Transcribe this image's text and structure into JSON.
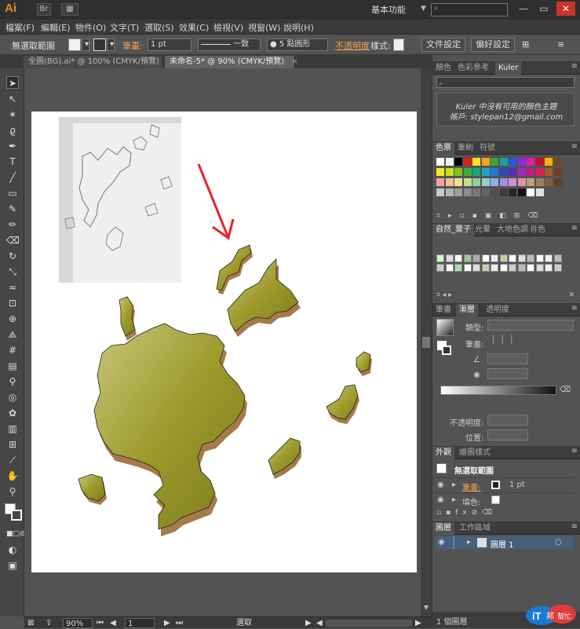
{
  "app": {
    "logo": "Ai",
    "workspace": "基本功能",
    "search_placeholder": "",
    "window_controls": [
      "—",
      "▭",
      "✕"
    ]
  },
  "menu": [
    "檔案(F)",
    "編輯(E)",
    "物件(O)",
    "文字(T)",
    "選取(S)",
    "效果(C)",
    "檢視(V)",
    "視窗(W)",
    "說明(H)"
  ],
  "control_bar": {
    "selection": "無選取範圍",
    "stroke_label": "筆畫:",
    "stroke_value": "1 pt",
    "stroke_style": "一致",
    "brush": "5 點圓形",
    "opacity_label": "不透明度",
    "style_label": "樣式:",
    "doc_setup_button": "文件設定",
    "prefs_button": "偏好設定"
  },
  "doc_tabs": [
    {
      "label": "全圖(BG).ai* @ 100% (CMYK/預覽)",
      "active": false
    },
    {
      "label": "未命名-5* @ 90% (CMYK/預覽)",
      "active": true
    }
  ],
  "status_bar": {
    "zoom": "90%",
    "page": "1",
    "status": "選取"
  },
  "panels": {
    "color_group": {
      "tabs": [
        "顏色",
        "色彩參考",
        "Kuler"
      ],
      "active": "Kuler",
      "message_line1": "Kuler 中沒有可用的顏色主題",
      "message_line2": "帳戶: stylepan12@gmail.com"
    },
    "swatches_group": {
      "tabs": [
        "色票",
        "筆刷",
        "符號"
      ],
      "active": "色票"
    },
    "library_group": {
      "tabs": [
        "自然_葉子",
        "光暈",
        "大地色調",
        "肖色"
      ],
      "active": "自然_葉子"
    },
    "gradient_group": {
      "tabs": [
        "筆畫",
        "漸層",
        "透明度"
      ],
      "active": "漸層",
      "type_label": "類型:",
      "stroke_label": "筆畫:",
      "opacity_label": "不透明度:",
      "position_label": "位置:"
    },
    "appearance_group": {
      "tabs": [
        "外觀",
        "繪圖樣式"
      ],
      "active": "外觀",
      "title": "無選取範圍",
      "stroke_label": "筆畫:",
      "stroke_value": "1 pt",
      "fill_label": "填色:"
    },
    "layers_group": {
      "tabs": [
        "圖層",
        "工作區域"
      ],
      "active": "圖層",
      "layer_name": "圖層 1",
      "count": "1 個圖層"
    }
  },
  "brand_logo": {
    "text1": "iT",
    "text2": "邦",
    "text3": "幫忙"
  },
  "colors": {
    "accent_red": "#e8202a",
    "map_fill": "#9c9a2a",
    "map_shadow": "#a67a4a"
  }
}
